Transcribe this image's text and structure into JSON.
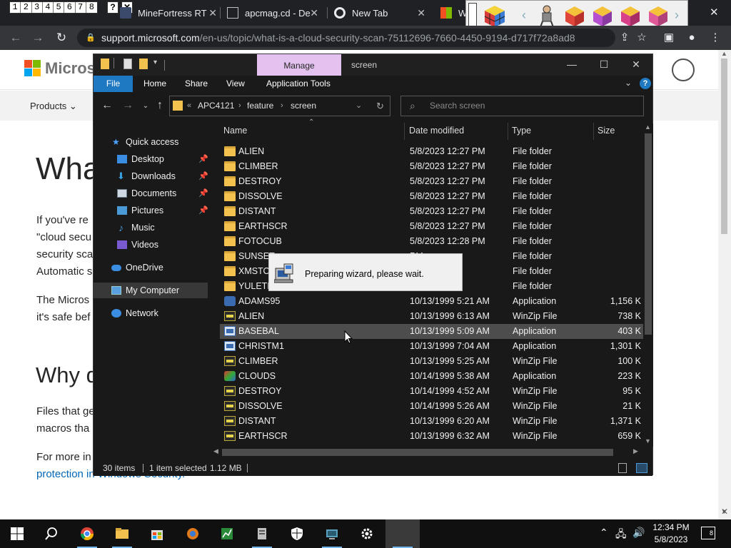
{
  "browser": {
    "number_buttons": [
      "1",
      "2",
      "3",
      "4",
      "5",
      "6",
      "7",
      "8"
    ],
    "help_button": "?",
    "close_small": "✕",
    "tabs": [
      {
        "title": "MineFortress RT"
      },
      {
        "title": "apcmag.cd - De"
      },
      {
        "title": "New Tab"
      },
      {
        "title": "W"
      }
    ],
    "tab_close": "✕",
    "url_host": "support.microsoft.com",
    "url_path": "/en-us/topic/what-is-a-cloud-security-scan-75112696-7660-4450-9194-d717f72a8ad8",
    "window_close": "✕",
    "page_close": "✕"
  },
  "webpage": {
    "brand": "Microso",
    "nav_products": "Products ⌄",
    "heading": "Wha",
    "para1": [
      "If you've re",
      "\"cloud secu",
      "security sca",
      "Automatic s"
    ],
    "para2": [
      "The Micros",
      "it's safe bef"
    ],
    "heading2": "Why d",
    "para3": [
      "Files that ge",
      "macros tha"
    ],
    "para4_line1": "For more in",
    "para4_link": "protection in Windows Security."
  },
  "explorer": {
    "manage_label": "Manage",
    "window_title": "screen",
    "ribbon_tabs": [
      "File",
      "Home",
      "Share",
      "View",
      "Application Tools"
    ],
    "help": "?",
    "address": {
      "prefix": "«",
      "segments": [
        "APC4121",
        "feature",
        "screen"
      ]
    },
    "search_placeholder": "Search screen",
    "nav": [
      {
        "label": "Quick access",
        "pinned": false
      },
      {
        "label": "Desktop",
        "pinned": true
      },
      {
        "label": "Downloads",
        "pinned": true
      },
      {
        "label": "Documents",
        "pinned": true
      },
      {
        "label": "Pictures",
        "pinned": true
      },
      {
        "label": "Music",
        "pinned": false
      },
      {
        "label": "Videos",
        "pinned": false
      },
      {
        "label": "OneDrive",
        "pinned": false
      },
      {
        "label": "My Computer",
        "pinned": false
      },
      {
        "label": "Network",
        "pinned": false
      }
    ],
    "pin_glyph": "📌",
    "columns": {
      "name": "Name",
      "date": "Date modified",
      "type": "Type",
      "size": "Size"
    },
    "files": [
      {
        "name": "ALIEN",
        "date": "5/8/2023 12:27 PM",
        "type": "File folder",
        "size": "",
        "icon": "folder-icon"
      },
      {
        "name": "CLIMBER",
        "date": "5/8/2023 12:27 PM",
        "type": "File folder",
        "size": "",
        "icon": "folder-icon"
      },
      {
        "name": "DESTROY",
        "date": "5/8/2023 12:27 PM",
        "type": "File folder",
        "size": "",
        "icon": "folder-icon"
      },
      {
        "name": "DISSOLVE",
        "date": "5/8/2023 12:27 PM",
        "type": "File folder",
        "size": "",
        "icon": "folder-icon"
      },
      {
        "name": "DISTANT",
        "date": "5/8/2023 12:27 PM",
        "type": "File folder",
        "size": "",
        "icon": "folder-icon"
      },
      {
        "name": "EARTHSCR",
        "date": "5/8/2023 12:27 PM",
        "type": "File folder",
        "size": "",
        "icon": "folder-icon"
      },
      {
        "name": "FOTOCUB",
        "date": "5/8/2023 12:28 PM",
        "type": "File folder",
        "size": "",
        "icon": "folder-icon"
      },
      {
        "name": "SUNSET",
        "date": "PM",
        "type": "File folder",
        "size": "",
        "icon": "folder-icon"
      },
      {
        "name": "XMSTOR",
        "date": "PM",
        "type": "File folder",
        "size": "",
        "icon": "folder-icon"
      },
      {
        "name": "YULETID",
        "date": "PM",
        "type": "File folder",
        "size": "",
        "icon": "folder-icon"
      },
      {
        "name": "ADAMS95",
        "date": "10/13/1999 5:21 AM",
        "type": "Application",
        "size": "1,156 K",
        "icon": "person-app-icon"
      },
      {
        "name": "ALIEN",
        "date": "10/13/1999 6:13 AM",
        "type": "WinZip File",
        "size": "738 K",
        "icon": "winzip-icon"
      },
      {
        "name": "BASEBAL",
        "date": "10/13/1999 5:09 AM",
        "type": "Application",
        "size": "403 K",
        "icon": "app-icon"
      },
      {
        "name": "CHRISTM1",
        "date": "10/13/1999 7:04 AM",
        "type": "Application",
        "size": "1,301 K",
        "icon": "app-icon"
      },
      {
        "name": "CLIMBER",
        "date": "10/13/1999 5:25 AM",
        "type": "WinZip File",
        "size": "100 K",
        "icon": "winzip-icon"
      },
      {
        "name": "CLOUDS",
        "date": "10/14/1999 5:38 AM",
        "type": "Application",
        "size": "223 K",
        "icon": "cloud-app-icon"
      },
      {
        "name": "DESTROY",
        "date": "10/14/1999 4:52 AM",
        "type": "WinZip File",
        "size": "95 K",
        "icon": "winzip-icon"
      },
      {
        "name": "DISSOLVE",
        "date": "10/14/1999 5:26 AM",
        "type": "WinZip File",
        "size": "21 K",
        "icon": "winzip-icon"
      },
      {
        "name": "DISTANT",
        "date": "10/13/1999 6:20 AM",
        "type": "WinZip File",
        "size": "1,371 K",
        "icon": "winzip-icon"
      },
      {
        "name": "EARTHSCR",
        "date": "10/13/1999 6:32 AM",
        "type": "WinZip File",
        "size": "659 K",
        "icon": "winzip-icon"
      }
    ],
    "selected_row": 12,
    "status": {
      "items": "30 items",
      "selected": "1 item selected",
      "size": "1.12 MB"
    }
  },
  "wizard": {
    "message": "Preparing wizard, please wait."
  },
  "taskbar": {
    "time": "12:34 PM",
    "date": "5/8/2023",
    "notifications": "8"
  },
  "colors": {
    "file_tab": "#1e78c2",
    "manage_tab": "#e3c2ef",
    "folder": "#f2c14e",
    "link": "#0067b8"
  }
}
